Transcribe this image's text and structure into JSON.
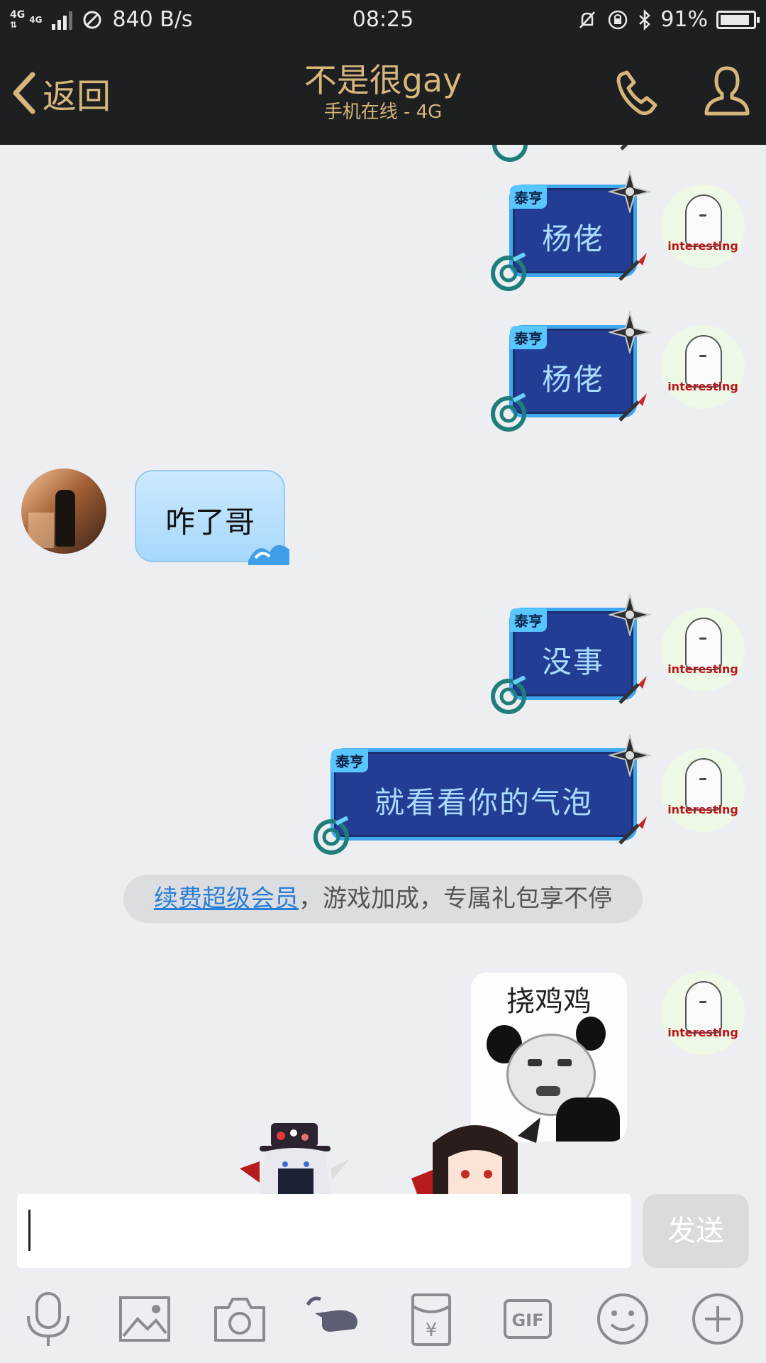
{
  "status": {
    "network_type": "4G",
    "network_type_2": "4G",
    "speed": "840 B/s",
    "time": "08:25",
    "battery": "91%",
    "battery_fraction": 0.91
  },
  "header": {
    "back_label": "返回",
    "title": "不是很gay",
    "subtitle": "手机在线 - 4G"
  },
  "messages": [
    {
      "side": "right",
      "tag": "泰亨",
      "text": "杨佬"
    },
    {
      "side": "right",
      "tag": "泰亨",
      "text": "杨佬"
    },
    {
      "side": "left",
      "text": "咋了哥"
    },
    {
      "side": "right",
      "tag": "泰亨",
      "text": "没事"
    },
    {
      "side": "right",
      "tag": "泰亨",
      "text": "就看看你的气泡"
    }
  ],
  "notice": {
    "link": "续费超级会员",
    "rest": "，游戏加成，专属礼包享不停"
  },
  "meme": {
    "caption": "挠鸡鸡"
  },
  "avatar_caption": "interesting",
  "input": {
    "placeholder": "",
    "send_label": "发送"
  },
  "toolbar": {
    "icons": [
      "microphone-icon",
      "image-icon",
      "camera-icon",
      "poke-icon",
      "red-packet-icon",
      "gif-icon",
      "emoji-icon",
      "plus-icon"
    ],
    "gif_label": "GIF",
    "yen_label": "¥"
  },
  "colors": {
    "header_bg": "#1e1f21",
    "header_text": "#d6b67a",
    "bubble_bg": "#233d94",
    "bubble_border": "#3fa7ef",
    "link": "#2c7ed6"
  }
}
